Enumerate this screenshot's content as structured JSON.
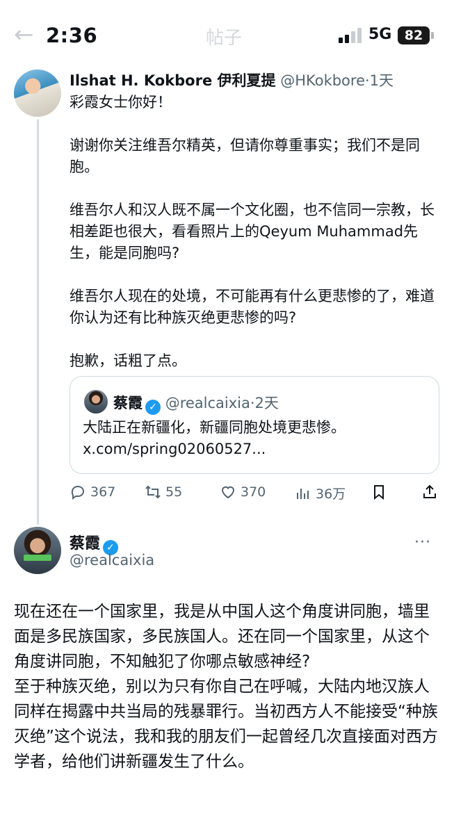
{
  "status_bar": {
    "time": "2:36",
    "title": "帖子",
    "network": "5G",
    "battery": "82"
  },
  "reply": {
    "author_name": "Ilshat H. Kokbore 伊利夏提",
    "handle": "@HKokbore",
    "time_ago": "·1天",
    "paragraphs": [
      "彩霞女士你好！",
      "",
      "谢谢你关注维吾尔精英，但请你尊重事实；我们不是同胞。",
      "",
      "维吾尔人和汉人既不属一个文化圈，也不信同一宗教，长相差距也很大，看看照片上的Qeyum Muhammad先生，能是同胞吗?",
      "",
      "维吾尔人现在的处境，不可能再有什么更悲惨的了，难道你认为还有比种族灭绝更悲惨的吗?",
      "",
      "抱歉，话粗了点。"
    ],
    "quote": {
      "author_name": "蔡霞",
      "handle": "@realcaixia",
      "time_ago": "·2天",
      "text": "大陆正在新疆化，新疆同胞处境更悲惨。 x.com/spring02060527..."
    },
    "stats": {
      "replies": "367",
      "retweets": "55",
      "likes": "370",
      "views": "36万"
    }
  },
  "main_post": {
    "author_name": "蔡霞",
    "handle": "@realcaixia",
    "text_lines": [
      "现在还在一个国家里，我是从中国人这个角度讲同胞，墙里面是多民族国家，多民族国人。还在同一个国家里，从这个角度讲同胞，不知触犯了你哪点敏感神经?",
      "至于种族灭绝，别以为只有你自己在呼喊，大陆内地汉族人同样在揭露中共当局的残暴罪行。当初西方人不能接受“种族灭绝”这个说法，我和我的朋友们一起曾经几次直接面对西方学者，给他们讲新疆发生了什么。"
    ]
  },
  "colors": {
    "verified_blue": "#1d9bf0",
    "muted_text": "#536471",
    "border": "#cfd9de"
  },
  "icons": [
    "back-arrow-icon",
    "signal-icon",
    "battery-icon",
    "verified-badge-icon",
    "reply-icon",
    "retweet-icon",
    "like-icon",
    "views-icon",
    "bookmark-icon",
    "share-icon",
    "more-icon"
  ]
}
